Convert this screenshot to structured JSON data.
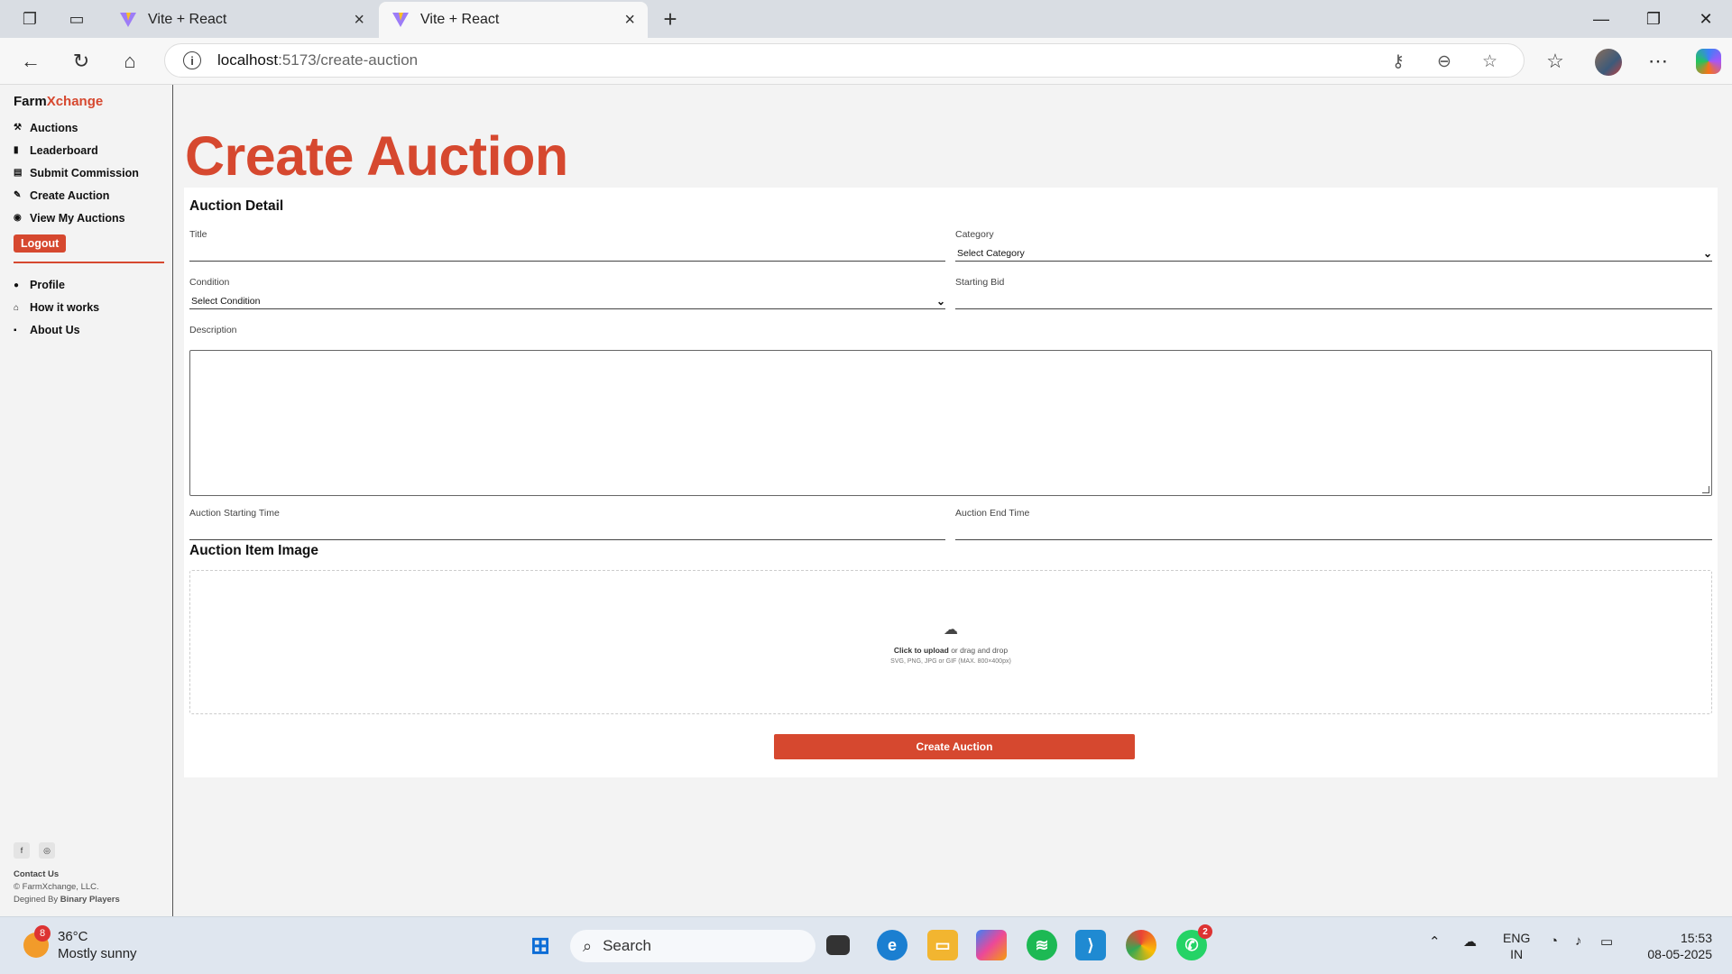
{
  "browser": {
    "tabs": [
      {
        "title": "Vite + React"
      },
      {
        "title": "Vite + React"
      }
    ],
    "url_host": "localhost",
    "url_path": ":5173/create-auction"
  },
  "sidebar": {
    "brand_part1": "Farm",
    "brand_part2": "Xchange",
    "items": [
      {
        "label": "Auctions",
        "icon": "gavel-icon"
      },
      {
        "label": "Leaderboard",
        "icon": "bar-chart-icon"
      },
      {
        "label": "Submit Commission",
        "icon": "receipt-icon"
      },
      {
        "label": "Create Auction",
        "icon": "pen-icon"
      },
      {
        "label": "View My Auctions",
        "icon": "eye-icon"
      }
    ],
    "logout": "Logout",
    "items2": [
      {
        "label": "Profile",
        "icon": "user-icon"
      },
      {
        "label": "How it works",
        "icon": "garage-icon"
      },
      {
        "label": "About Us",
        "icon": "info-icon"
      }
    ],
    "contact": "Contact Us",
    "copyright": "© FarmXchange, LLC.",
    "designed_prefix": "Degined By ",
    "designed_by": "Binary Players"
  },
  "main": {
    "title": "Create Auction",
    "section_detail": "Auction Detail",
    "title_label": "Title",
    "category_label": "Category",
    "category_value": "Select Category",
    "condition_label": "Condition",
    "condition_value": "Select Condition",
    "starting_bid_label": "Starting Bid",
    "description_label": "Description",
    "start_time_label": "Auction Starting Time",
    "end_time_label": "Auction End Time",
    "section_image": "Auction Item Image",
    "upload_bold": "Click to upload",
    "upload_rest": " or drag and drop",
    "upload_hint": "SVG, PNG, JPG or GIF (MAX. 800×400px)",
    "submit_label": "Create Auction"
  },
  "taskbar": {
    "temperature": "36°C",
    "weather": "Mostly sunny",
    "weather_badge": "8",
    "search": "Search",
    "whatsapp_badge": "2",
    "lang1": "ENG",
    "lang2": "IN",
    "time": "15:53",
    "date": "08-05-2025"
  },
  "colors": {
    "accent": "#d6482f"
  }
}
